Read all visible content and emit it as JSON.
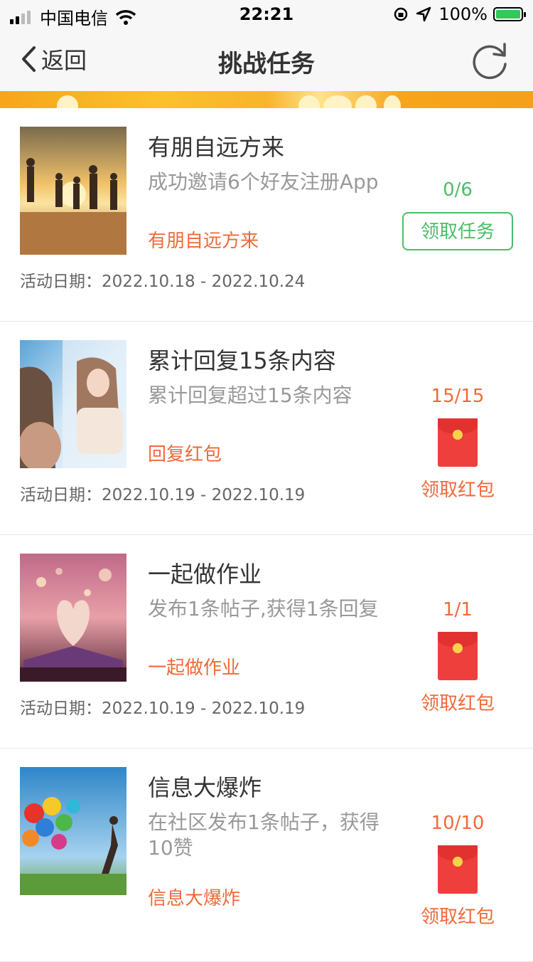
{
  "status_bar": {
    "carrier": "中国电信",
    "time": "22:21",
    "battery": "100%"
  },
  "nav": {
    "back_label": "返回",
    "title": "挑战任务"
  },
  "colors": {
    "accent_green": "#4cbe67",
    "accent_orange": "#ef6a3a",
    "redpack": "#ef3f3c"
  },
  "tasks": [
    {
      "title": "有朋自远方来",
      "desc": "成功邀请6个好友注册App",
      "tag": "有朋自远方来",
      "date": "活动日期：2022.10.18 - 2022.10.24",
      "progress": "0/6",
      "action": "领取任务"
    },
    {
      "title": "累计回复15条内容",
      "desc": "累计回复超过15条内容",
      "tag": "回复红包",
      "date": "活动日期：2022.10.19 - 2022.10.19",
      "progress": "15/15",
      "action": "领取红包"
    },
    {
      "title": "一起做作业",
      "desc": "发布1条帖子,获得1条回复",
      "tag": "一起做作业",
      "date": "活动日期：2022.10.19 - 2022.10.19",
      "progress": "1/1",
      "action": "领取红包"
    },
    {
      "title": "信息大爆炸",
      "desc": "在社区发布1条帖子，获得10赞",
      "tag": "信息大爆炸",
      "date": "",
      "progress": "10/10",
      "action": "领取红包"
    }
  ]
}
